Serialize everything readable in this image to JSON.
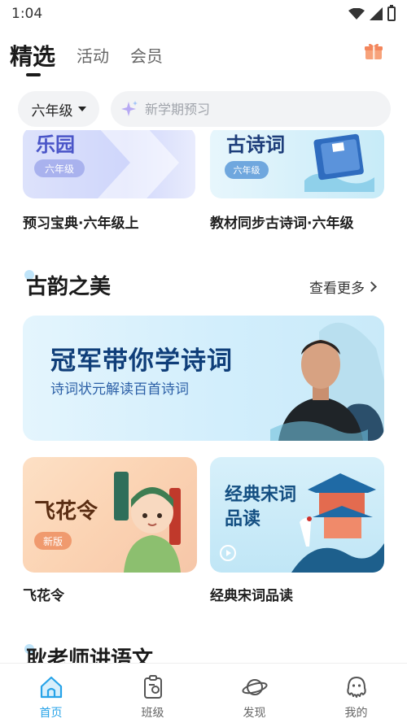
{
  "status_bar": {
    "time": "1:04"
  },
  "top_tabs": [
    {
      "label": "精选",
      "active": true
    },
    {
      "label": "活动",
      "active": false
    },
    {
      "label": "会员",
      "active": false
    }
  ],
  "grade_selector": {
    "value": "六年级"
  },
  "search": {
    "placeholder": "新学期预习"
  },
  "top_banners": [
    {
      "banner_title": "乐园",
      "tag": "六年级",
      "caption": "预习宝典·六年级上"
    },
    {
      "banner_title": "古诗词",
      "tag": "六年级",
      "caption": "教材同步古诗词·六年级"
    }
  ],
  "section_guyun": {
    "title": "古韵之美",
    "see_more": "查看更多",
    "banner": {
      "title": "冠军带你学诗词",
      "subtitle": "诗词状元解读百首诗词"
    },
    "cards": [
      {
        "banner_title": "飞花令",
        "tag": "新版",
        "caption": "飞花令"
      },
      {
        "banner_title": "经典宋词品读",
        "caption": "经典宋词品读"
      }
    ]
  },
  "section_geng": {
    "title": "耿老师讲语文"
  },
  "bottom_nav": [
    {
      "label": "首页",
      "icon": "home-icon",
      "active": true
    },
    {
      "label": "班级",
      "icon": "class-icon",
      "active": false
    },
    {
      "label": "发现",
      "icon": "planet-icon",
      "active": false
    },
    {
      "label": "我的",
      "icon": "octopus-icon",
      "active": false
    }
  ],
  "colors": {
    "accent": "#27a3e8",
    "title_text": "#1b1b1b"
  }
}
